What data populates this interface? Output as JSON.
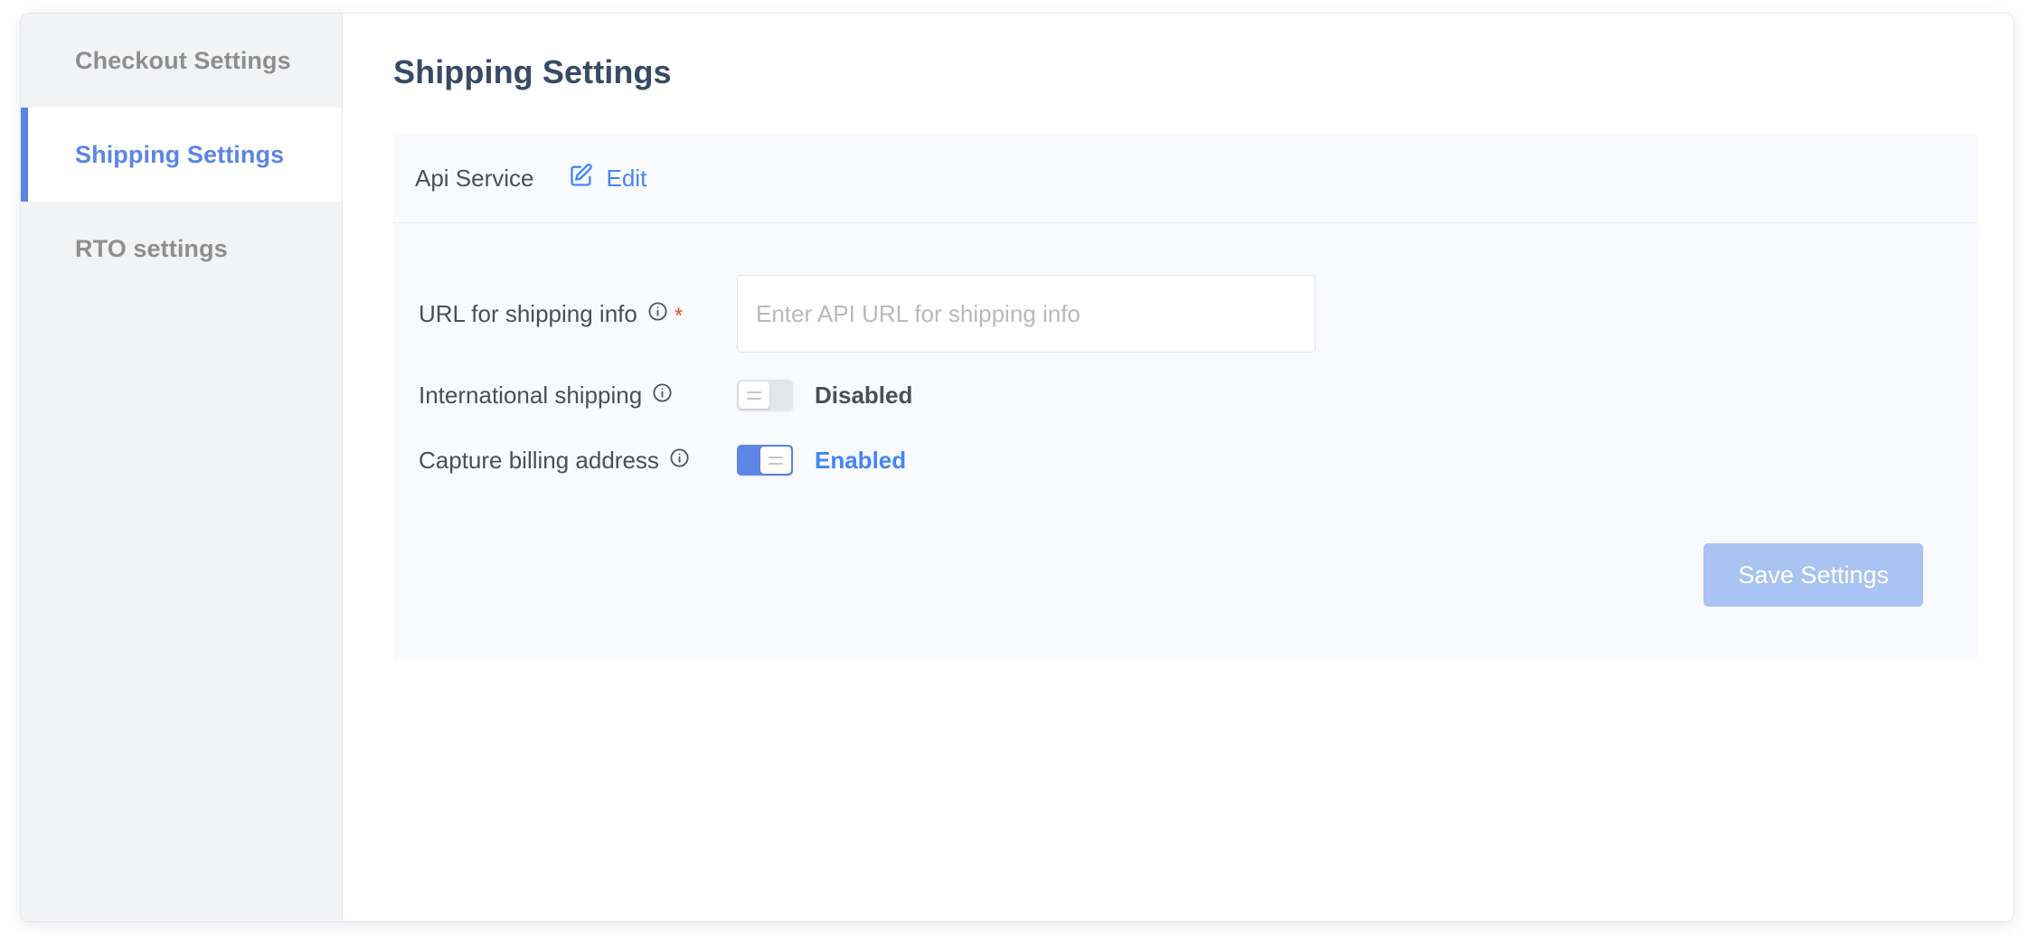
{
  "sidebar": {
    "items": [
      {
        "label": "Checkout Settings",
        "active": false
      },
      {
        "label": "Shipping Settings",
        "active": true
      },
      {
        "label": "RTO settings",
        "active": false
      }
    ]
  },
  "main": {
    "page_title": "Shipping Settings",
    "card": {
      "header": {
        "service_label": "Api Service",
        "edit_label": "Edit",
        "edit_icon": "edit-pencil-square-icon"
      },
      "fields": [
        {
          "label": "URL for shipping info",
          "info_icon": "info-circle-icon",
          "required_marker": "*",
          "input_placeholder": "Enter API URL for shipping info",
          "input_value": ""
        },
        {
          "label": "International shipping",
          "info_icon": "info-circle-icon",
          "toggle_state": "off",
          "toggle_text": "Disabled"
        },
        {
          "label": "Capture billing address",
          "info_icon": "info-circle-icon",
          "toggle_state": "on",
          "toggle_text": "Enabled"
        }
      ],
      "save_label": "Save Settings"
    }
  },
  "colors": {
    "accent_blue": "#5b86e5",
    "link_blue": "#4286f5",
    "title_navy": "#374a66",
    "sidebar_bg": "#f2f3f5",
    "card_bg": "#f9fafd",
    "required_red": "#e8493a",
    "save_button_bg": "#a9c3f2",
    "toggle_off_track": "#e4e6ea"
  }
}
